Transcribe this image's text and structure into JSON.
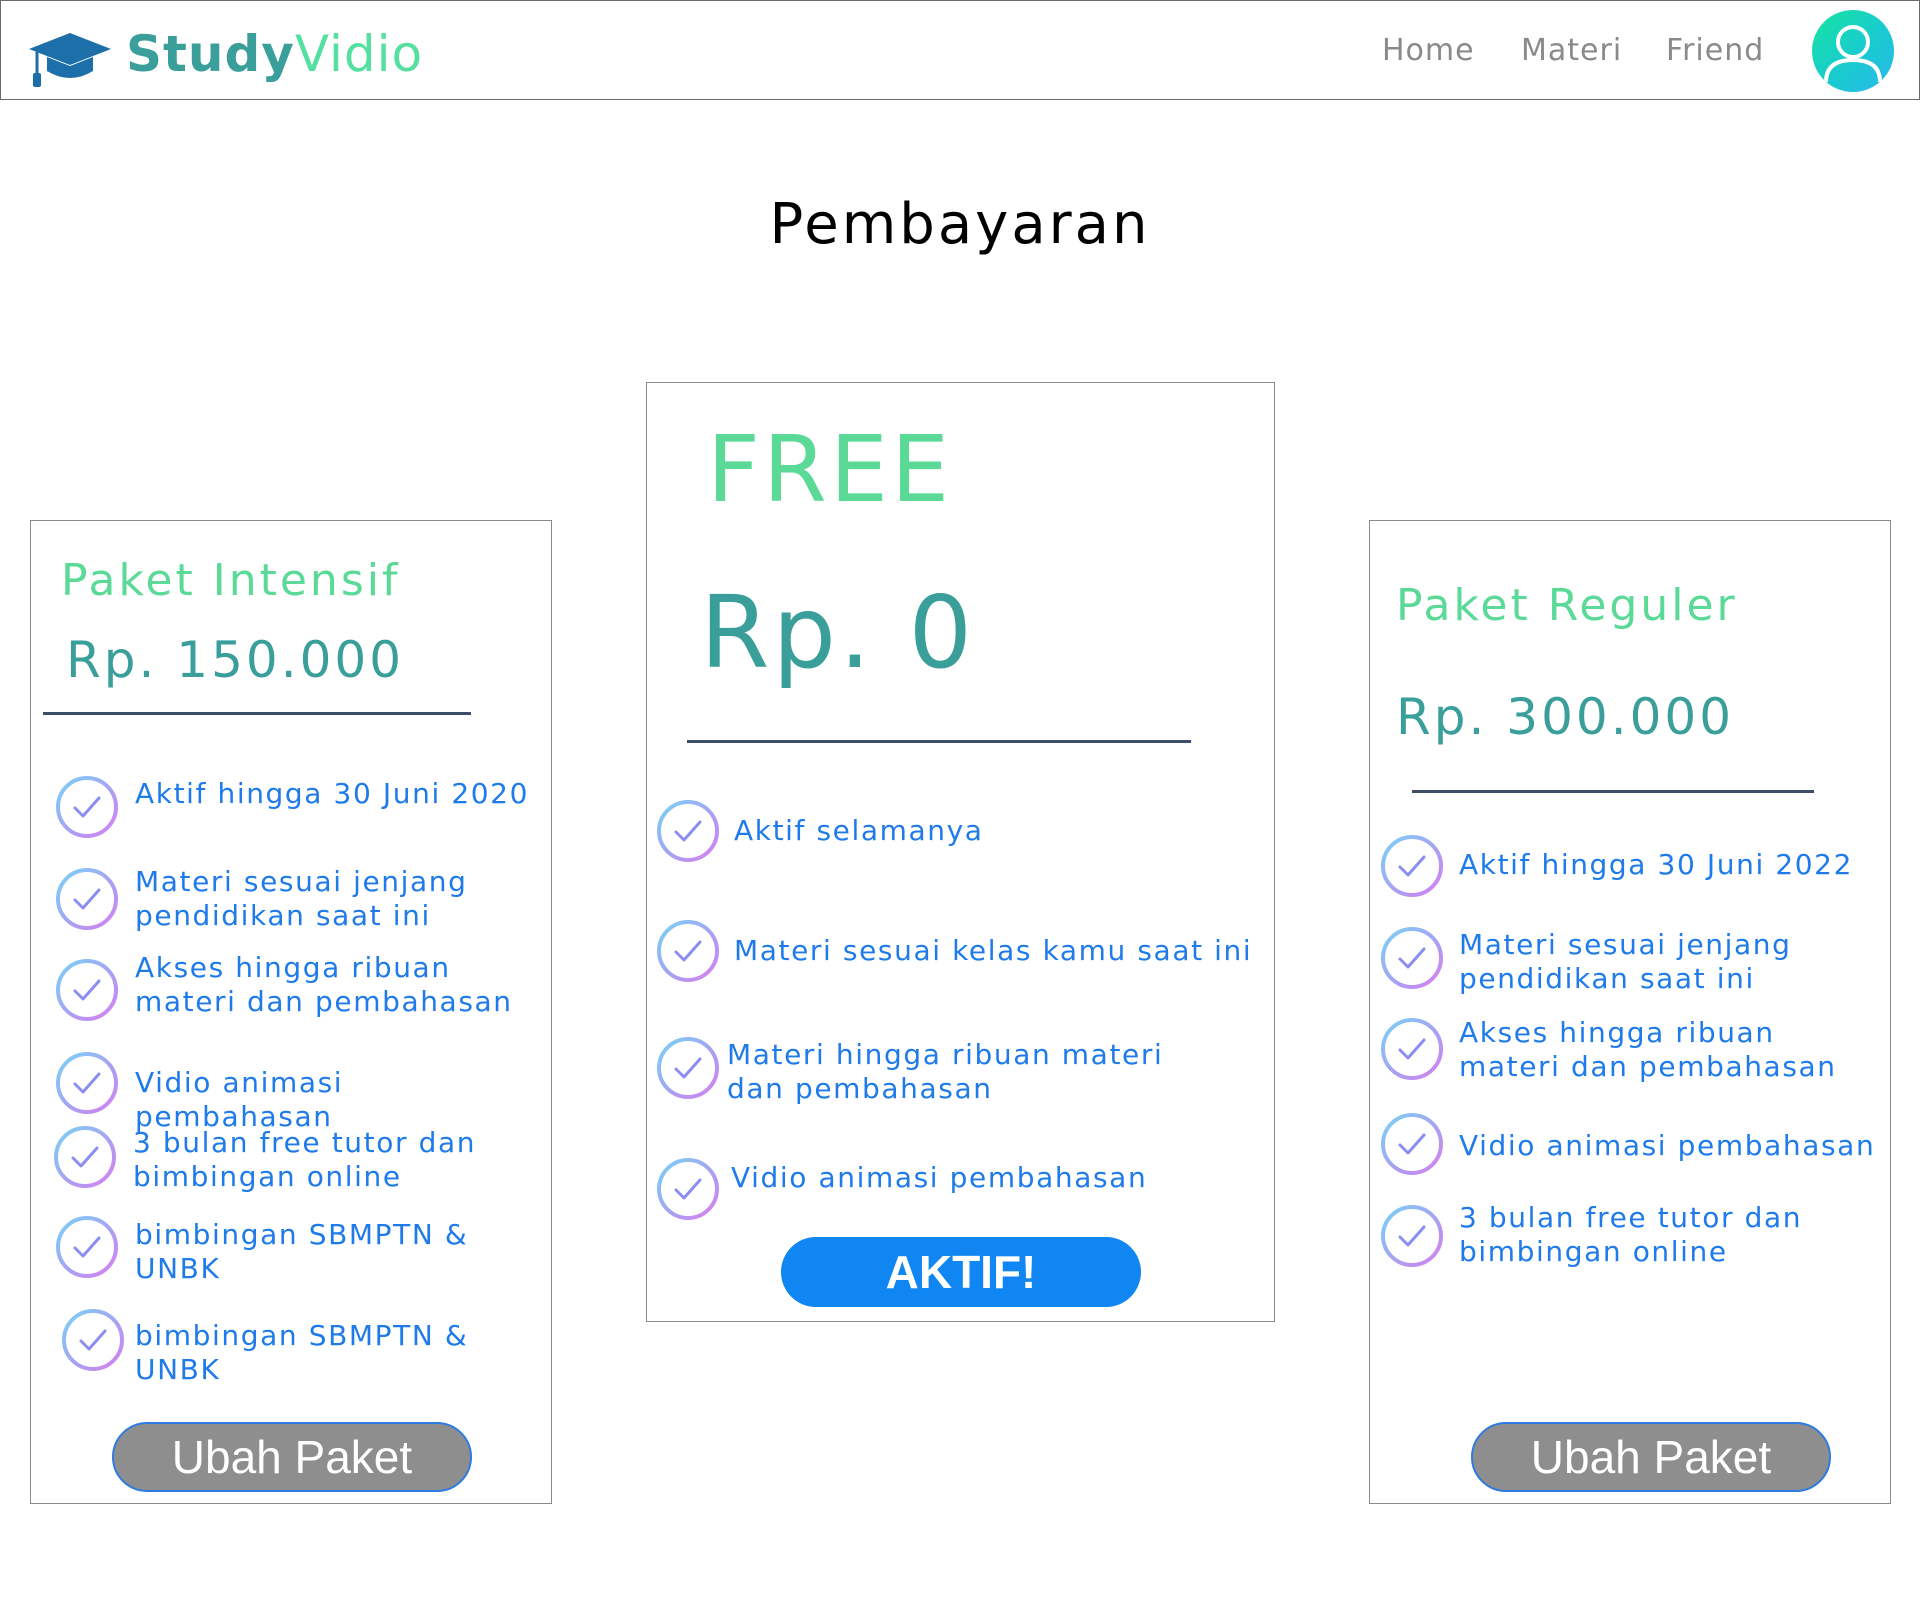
{
  "header": {
    "brand_bold": "Study",
    "brand_light": "Vidio",
    "logo_icon": "graduation-cap-icon",
    "nav": [
      "Home",
      "Materi",
      "Friend"
    ],
    "avatar_icon": "user-icon"
  },
  "page": {
    "title": "Pembayaran"
  },
  "colors": {
    "brand": "#3a9e9a",
    "package_name": "#5bd996",
    "feature_text": "#1f7bea",
    "divider": "#3e4e68",
    "active_button": "#0f86f2",
    "inactive_button": "#8e8e8e"
  },
  "plans": {
    "intensif": {
      "name": "Paket Intensif",
      "price": "Rp. 150.000",
      "features": [
        "Aktif hingga 30 Juni 2020",
        "Materi sesuai jenjang pendidikan saat ini",
        "Akses hingga ribuan materi dan pembahasan",
        "Vidio animasi pembahasan",
        "3 bulan free tutor dan bimbingan online",
        "bimbingan SBMPTN & UNBK",
        "bimbingan SBMPTN & UNBK"
      ],
      "button": "Ubah Paket"
    },
    "free": {
      "name": "FREE",
      "price": "Rp. 0",
      "features": [
        "Aktif selamanya",
        "Materi sesuai kelas kamu saat ini",
        "Materi hingga ribuan materi dan pembahasan",
        "Vidio animasi pembahasan"
      ],
      "button": "AKTIF!"
    },
    "reguler": {
      "name": "Paket Reguler",
      "price": "Rp. 300.000",
      "features": [
        "Aktif hingga 30 Juni 2022",
        "Materi sesuai jenjang pendidikan saat ini",
        "Akses hingga ribuan materi dan pembahasan",
        "Vidio animasi pembahasan",
        "3 bulan free tutor dan bimbingan online"
      ],
      "button": "Ubah Paket"
    }
  }
}
